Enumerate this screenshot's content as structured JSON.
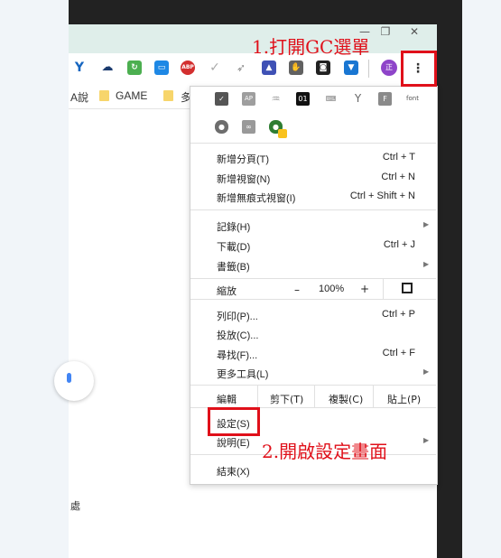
{
  "annotations": {
    "step1": "1.打開GC選單",
    "step2": "2.開啟設定畫面"
  },
  "bookmarks": {
    "item1_fragment": "A說",
    "item2": "GAME",
    "item3_fragment": "多"
  },
  "profile": {
    "avatar_label": "正"
  },
  "page": {
    "bottom_text_fragment": "處"
  },
  "extensions": {
    "abp_label": "ABP"
  },
  "menu": {
    "extension_labels": {
      "ap": "AP",
      "zero_one": "01",
      "f": "F",
      "font": "font"
    },
    "new_tab": {
      "label": "新增分頁(T)",
      "shortcut": "Ctrl + T"
    },
    "new_window": {
      "label": "新增視窗(N)",
      "shortcut": "Ctrl + N"
    },
    "new_incognito": {
      "label": "新增無痕式視窗(I)",
      "shortcut": "Ctrl + Shift + N"
    },
    "history": {
      "label": "記錄(H)"
    },
    "downloads": {
      "label": "下載(D)",
      "shortcut": "Ctrl + J"
    },
    "bookmarks": {
      "label": "書籤(B)"
    },
    "zoom": {
      "label": "縮放",
      "minus": "–",
      "value": "100%",
      "plus": "+"
    },
    "print": {
      "label": "列印(P)...",
      "shortcut": "Ctrl + P"
    },
    "cast": {
      "label": "投放(C)..."
    },
    "find": {
      "label": "尋找(F)...",
      "shortcut": "Ctrl + F"
    },
    "more_tools": {
      "label": "更多工具(L)"
    },
    "edit": {
      "label": "編輯",
      "cut": "剪下(T)",
      "copy": "複製(C)",
      "paste": "貼上(P)"
    },
    "settings": {
      "label": "設定(S)"
    },
    "help": {
      "label": "說明(E)"
    },
    "exit": {
      "label": "結束(X)"
    }
  },
  "colors": {
    "annotation_red": "#e0101a",
    "tabstrip": "#dfeeea",
    "profile_avatar": "#8e44c9"
  }
}
